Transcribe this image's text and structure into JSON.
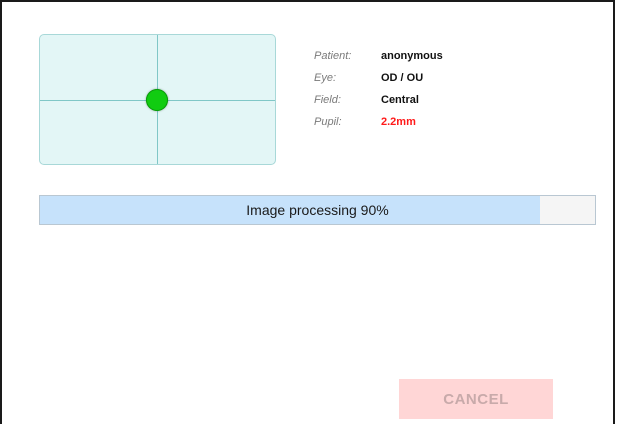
{
  "patient_info": {
    "patient_label": "Patient:",
    "patient_value": "anonymous",
    "eye_label": "Eye:",
    "eye_value": "OD / OU",
    "field_label": "Field:",
    "field_value": "Central",
    "pupil_label": "Pupil:",
    "pupil_value": "2.2mm"
  },
  "progress": {
    "label": "Image processing 90%",
    "fraction": 0.9
  },
  "actions": {
    "cancel_label": "CANCEL"
  },
  "colors": {
    "fixation_dot": "#11cc11",
    "pupil_warning": "#ff1a1a",
    "progress_fill": "#c6e2fb",
    "cancel_background": "#ffd6d6"
  }
}
